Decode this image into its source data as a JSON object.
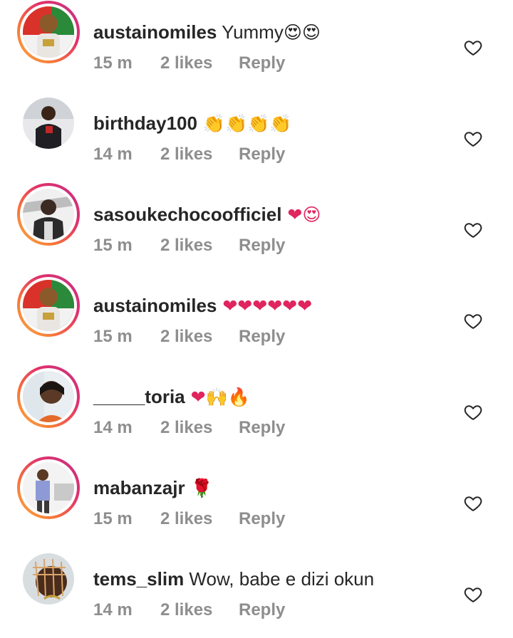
{
  "comments": [
    {
      "username": "austainomiles",
      "text": "Yummy",
      "emojis": "😍😍",
      "time": "15 m",
      "likes": "2 likes",
      "reply": "Reply",
      "avatar_ring": "story",
      "avatar_icon": "avatar-austainomiles"
    },
    {
      "username": "birthday100",
      "text": "",
      "emojis": " 👏👏👏👏",
      "time": "14 m",
      "likes": "2 likes",
      "reply": "Reply",
      "avatar_ring": "none",
      "avatar_icon": "avatar-birthday100"
    },
    {
      "username": "sasoukechocoofficiel",
      "text": "",
      "emojis": " ❤😍",
      "time": "15 m",
      "likes": "2 likes",
      "reply": "Reply",
      "avatar_ring": "story",
      "avatar_icon": "avatar-sasoukechocoofficiel"
    },
    {
      "username": "austainomiles",
      "text": "",
      "emojis": " ❤❤❤❤❤❤",
      "time": "15 m",
      "likes": "2 likes",
      "reply": "Reply",
      "avatar_ring": "story",
      "avatar_icon": "avatar-austainomiles"
    },
    {
      "username": "_____toria",
      "text": "",
      "emojis": " ❤🙌🔥",
      "time": "14 m",
      "likes": "2 likes",
      "reply": "Reply",
      "avatar_ring": "story",
      "avatar_icon": "avatar-toria"
    },
    {
      "username": "mabanzajr",
      "text": "",
      "emojis": " 🌹",
      "time": "15 m",
      "likes": "2 likes",
      "reply": "Reply",
      "avatar_ring": "story",
      "avatar_icon": "avatar-mabanzajr"
    },
    {
      "username": "tems_slim",
      "text": "Wow, babe e dizi okun",
      "emojis": "",
      "time": "14 m",
      "likes": "2 likes",
      "reply": "Reply",
      "avatar_ring": "none",
      "avatar_icon": "avatar-tems_slim"
    }
  ],
  "colors": {
    "text": "#262626",
    "meta": "#8e8e8e",
    "heart": "#e0245e"
  },
  "icons": {
    "like": "heart-outline-icon"
  }
}
